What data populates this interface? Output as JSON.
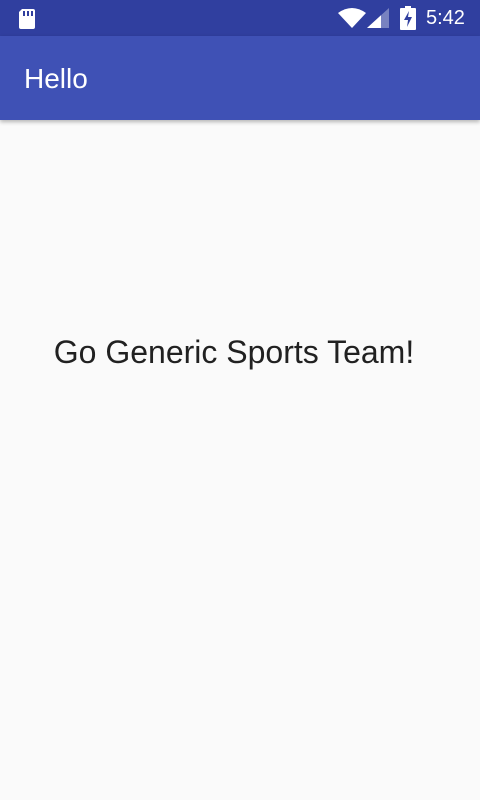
{
  "status_bar": {
    "time": "5:42",
    "icons": [
      "sd-card-icon",
      "wifi-icon",
      "cell-signal-icon",
      "battery-charging-icon"
    ],
    "background_color": "#303f9f"
  },
  "app_bar": {
    "title": "Hello",
    "background_color": "#3f51b5"
  },
  "main": {
    "message": "Go Generic Sports Team!"
  }
}
